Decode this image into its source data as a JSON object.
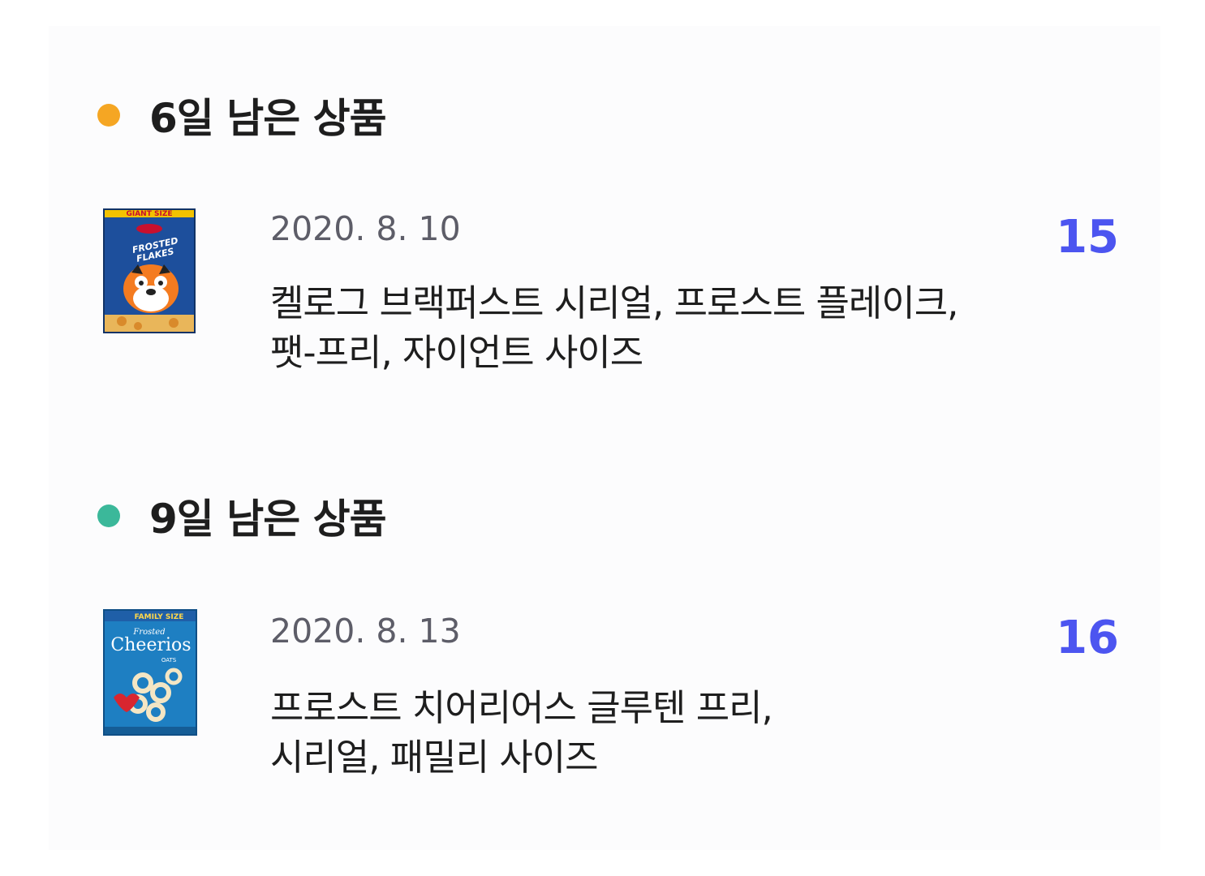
{
  "sections": [
    {
      "title": "6일 남은 상품",
      "dot_color": "#f5a623",
      "item": {
        "date": "2020. 8. 10",
        "name_lines": [
          "켈로그 브랙퍼스트 시리얼, 프로스트 플레이크,",
          "팻-프리, 자이언트 사이즈"
        ],
        "count": "15",
        "image_icon": "frosted-flakes-box-image",
        "image_texts": [
          "GIANT SIZE",
          "FROSTED",
          "FLAKES"
        ]
      }
    },
    {
      "title": "9일 남은 상품",
      "dot_color": "#3bb89a",
      "item": {
        "date": "2020. 8. 13",
        "name_lines": [
          "프로스트 치어리어스 글루텐 프리,",
          "시리얼, 패밀리 사이즈"
        ],
        "count": "16",
        "image_icon": "cheerios-box-image",
        "image_texts": [
          "FAMILY SIZE",
          "Frosted",
          "Cheerios",
          "OATS"
        ]
      }
    }
  ],
  "colors": {
    "accent_count": "#4c55f0",
    "date_text": "#5d5d68"
  }
}
